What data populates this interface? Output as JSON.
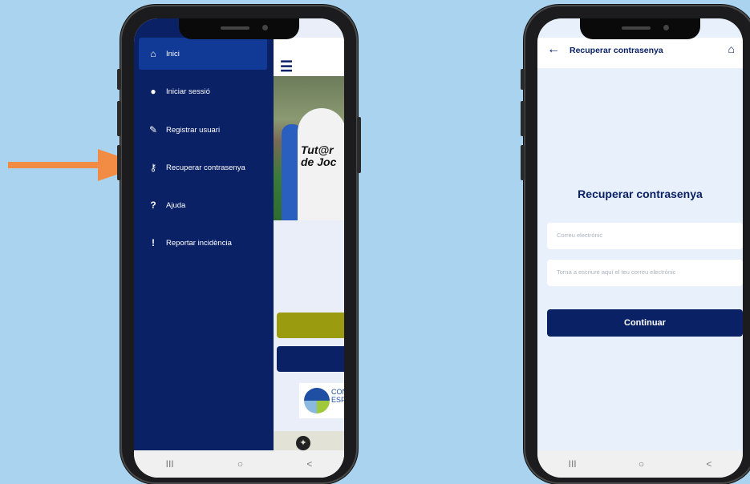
{
  "left_phone": {
    "drawer": {
      "items": [
        {
          "label": "Inici",
          "icon": "home-icon",
          "glyph": "⌂"
        },
        {
          "label": "Iniciar sessió",
          "icon": "user-icon",
          "glyph": "●"
        },
        {
          "label": "Registrar usuari",
          "icon": "edit-icon",
          "glyph": "✎"
        },
        {
          "label": "Recuperar contrasenya",
          "icon": "key-icon",
          "glyph": "⚷"
        },
        {
          "label": "Ajuda",
          "icon": "question-icon",
          "glyph": "?"
        },
        {
          "label": "Reportar incidència",
          "icon": "exclamation-icon",
          "glyph": "!"
        }
      ],
      "active_index": 0
    },
    "background": {
      "photo_text": "Tut@r de Joc",
      "logo_text": "CONS ESPO"
    }
  },
  "right_phone": {
    "topbar": {
      "title": "Recuperar contrasenya"
    },
    "heading": "Recuperar contrasenya",
    "email_placeholder": "Correu electrònic",
    "email_confirm_placeholder": "Torna a escriure aquí el teu correu electrònic",
    "continue_label": "Continuar"
  },
  "android_nav": {
    "recent": "III",
    "home": "○",
    "back": "<"
  },
  "colors": {
    "navy": "#0a2166",
    "active_item": "#113996",
    "olive": "#9b9b10",
    "arrow": "#f28c45",
    "background": "#a9d3ee"
  }
}
